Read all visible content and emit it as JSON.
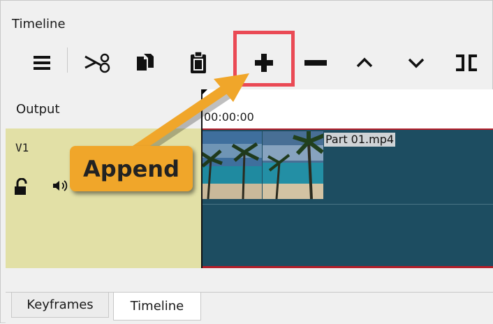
{
  "panel": {
    "title": "Timeline"
  },
  "toolbar": {
    "buttons": [
      {
        "name": "menu-icon"
      },
      {
        "name": "cut-icon"
      },
      {
        "name": "copy-icon"
      },
      {
        "name": "paste-icon"
      },
      {
        "name": "append-icon"
      },
      {
        "name": "remove-icon"
      },
      {
        "name": "lift-icon"
      },
      {
        "name": "overwrite-icon"
      },
      {
        "name": "split-icon"
      }
    ]
  },
  "tracks": {
    "output_label": "Output",
    "timecode": "00:00:00",
    "v1_label": "V1",
    "clip_name": "Part 01.mp4"
  },
  "callout": {
    "text": "Append",
    "color": "#f0a62a",
    "highlight_color": "#ea4a55"
  },
  "tabs": [
    {
      "label": "Keyframes"
    },
    {
      "label": "Timeline"
    }
  ],
  "colors": {
    "track_header": "#e2e0a6",
    "clip": "#1d4d61",
    "clip_border": "#b51f2a"
  }
}
